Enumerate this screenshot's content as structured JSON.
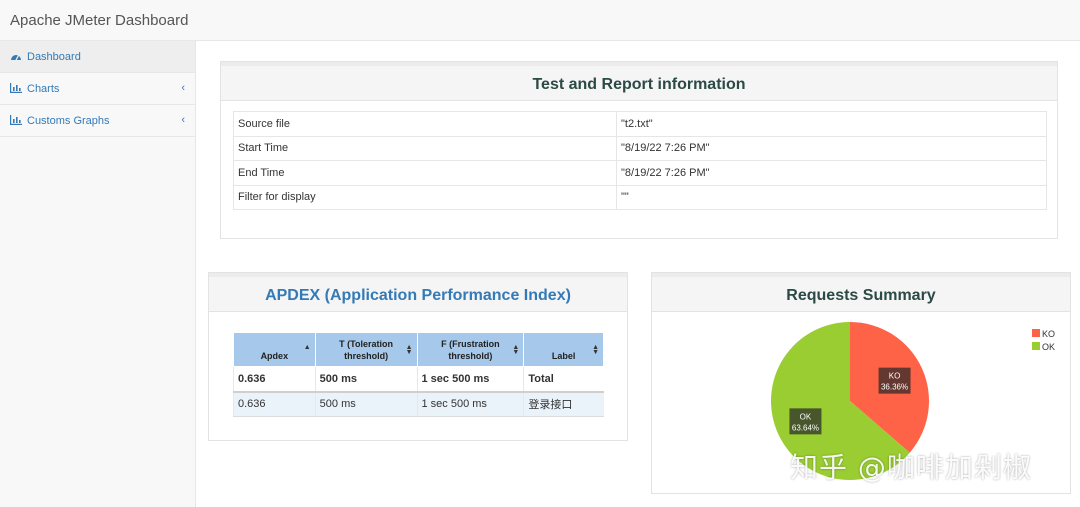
{
  "app": {
    "title": "Apache JMeter Dashboard"
  },
  "sidebar": {
    "items": [
      {
        "label": "Dashboard",
        "icon": "dashboard-gauge-icon",
        "active": true
      },
      {
        "label": "Charts",
        "icon": "bar-chart-icon"
      },
      {
        "label": "Customs Graphs",
        "icon": "bar-chart-icon"
      }
    ]
  },
  "info": {
    "title": "Test and Report information",
    "rows": [
      {
        "key": "Source file",
        "value": "\"t2.txt\""
      },
      {
        "key": "Start Time",
        "value": "\"8/19/22 7:26 PM\""
      },
      {
        "key": "End Time",
        "value": "\"8/19/22 7:26 PM\""
      },
      {
        "key": "Filter for display",
        "value": "\"\""
      }
    ]
  },
  "apdex": {
    "title": "APDEX (Application Performance Index)",
    "headers": [
      "Apdex",
      "T (Toleration threshold)",
      "F (Frustration threshold)",
      "Label"
    ],
    "rows": [
      [
        "0.636",
        "500 ms",
        "1 sec 500 ms",
        "Total"
      ],
      [
        "0.636",
        "500 ms",
        "1 sec 500 ms",
        "登录接口"
      ]
    ],
    "header_color": "#a6c8ea"
  },
  "requests": {
    "title": "Requests Summary",
    "chart_data": {
      "type": "pie",
      "labels": [
        "KO",
        "OK"
      ],
      "values": [
        36.36,
        63.64
      ],
      "value_labels": [
        "36.36%",
        "63.64%"
      ],
      "colors": [
        "#ff6347",
        "#9acd32"
      ],
      "legend": "top-right"
    }
  },
  "watermark": "知乎 @咖啡加剁椒"
}
